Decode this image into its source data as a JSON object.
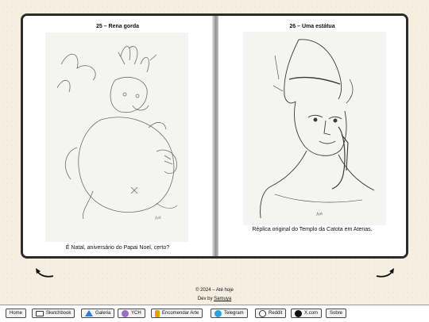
{
  "left_page": {
    "title": "25 – Rena gorda",
    "caption": "É Natal, aniversário do Papai Noel, certo?"
  },
  "right_page": {
    "title": "26 – Uma estátua",
    "caption": "Réplica original do Templo da Catota em Atenas."
  },
  "navigation": {
    "prev_icon": "curved-arrow-left-icon",
    "next_icon": "curved-arrow-right-icon"
  },
  "footer": {
    "copyright": "© 2024 – Até hoje",
    "dev_prefix": "Dev by ",
    "dev_name": "Samuya"
  },
  "menu": {
    "home": "Home",
    "sketchbook": "Sketchbook",
    "galeria": "Galeria",
    "ych": "YCH",
    "encomendar": "Encomendar Arte",
    "telegram": "Telegram",
    "reddit": "Reddit",
    "xcom": "X.com",
    "sobre": "Sobre"
  },
  "colors": {
    "background": "#f6efe1",
    "book_border": "#2b2b2b",
    "telegram": "#2aa3dc",
    "galeria": "#2f7bd6",
    "ych": "#9b6cc6",
    "encomendar": "#e0a400"
  }
}
